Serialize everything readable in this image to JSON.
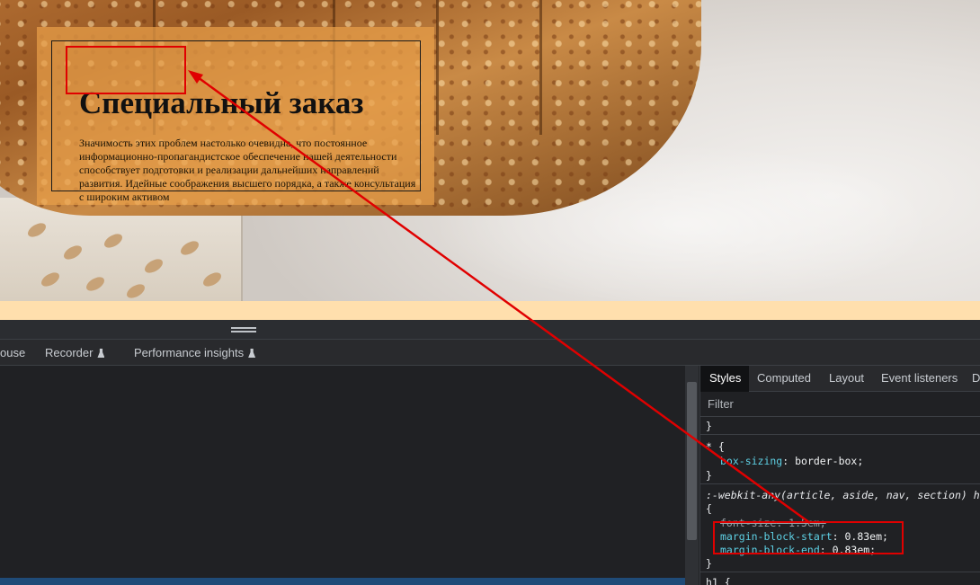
{
  "page": {
    "card": {
      "heading": "Специальный заказ",
      "body": "Значимость этих проблем настолько очевидна, что постоянное информационно-пропагандистское обеспечение нашей деятельности способствует подготовки и реализации дальнейших направлений развития. Идейные соображения высшего порядка, а также консультация с широким активом"
    },
    "colors": {
      "card_bg": "#e9a04a",
      "page_bg": "#ffdfad",
      "annotation": "#e00000"
    }
  },
  "devtools": {
    "tabs": [
      "ouse",
      "Recorder",
      "Performance insights"
    ],
    "styles_tabs": [
      "Styles",
      "Computed",
      "Layout",
      "Event listeners",
      "D"
    ],
    "filter_placeholder": "Filter",
    "css": {
      "close_brace_1": "}",
      "universal_selector": "* {",
      "box_sizing_prop": "box-sizing",
      "box_sizing_val": "border-box;",
      "close_brace_2": "}",
      "webkit_selector": ":-webkit-any(article, aside, nav, section) h1",
      "open_brace": "{",
      "font_size_prop": "font-size",
      "font_size_val": "1.5em;",
      "margin_start_prop": "margin-block-start",
      "margin_start_val": "0.83em;",
      "margin_end_prop": "margin-block-end",
      "margin_end_val": "0.83em;",
      "close_brace_3": "}",
      "h1_selector": "h1 {"
    }
  }
}
